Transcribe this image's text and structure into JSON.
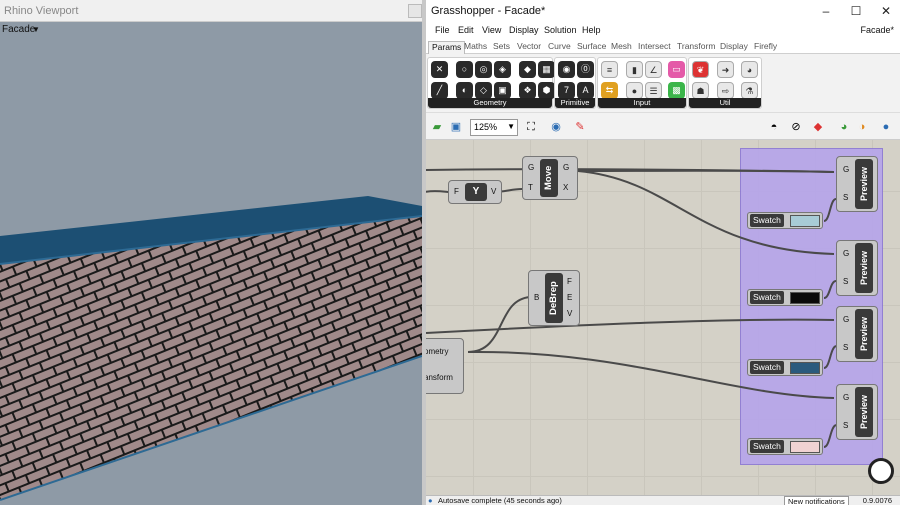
{
  "rhino": {
    "window_title": "Rhino Viewport",
    "viewport_name": "Facade"
  },
  "grasshopper": {
    "window_title": "Grasshopper - Facade*",
    "document_name": "Facade*",
    "menu": [
      "File",
      "Edit",
      "View",
      "Display",
      "Solution",
      "Help"
    ],
    "tabs": [
      "Params",
      "Maths",
      "Sets",
      "Vector",
      "Curve",
      "Surface",
      "Mesh",
      "Intersect",
      "Transform",
      "Display",
      "Firefly"
    ],
    "active_tab": "Params",
    "ribbon_groups": [
      "Geometry",
      "Primitive",
      "Input",
      "Util"
    ],
    "zoom": "125%",
    "nodes": {
      "y_label": "Y",
      "y_input": "F",
      "y_output": "V",
      "move_label": "Move",
      "move_inputs": [
        "G",
        "T"
      ],
      "move_outputs": [
        "G",
        "X"
      ],
      "debrep_label": "DeBrep",
      "debrep_input": "B",
      "debrep_outputs": [
        "F",
        "E",
        "V"
      ],
      "transform_outputs": [
        "ometry",
        "ansform"
      ],
      "preview_label": "Preview",
      "preview_inputs": [
        "G",
        "S"
      ],
      "swatch_label": "Swatch"
    },
    "swatch_colors": [
      "#a8cbd6",
      "#0a0a0a",
      "#2b5a7d",
      "#f0d2d2"
    ],
    "status": "Autosave complete (45 seconds ago)",
    "notifications": "New notifications",
    "version": "0.9.0076"
  },
  "colors": {
    "group_fill": "#b7a6e9",
    "wall_top": "#1c4f73",
    "panel": "#a08a8a"
  }
}
